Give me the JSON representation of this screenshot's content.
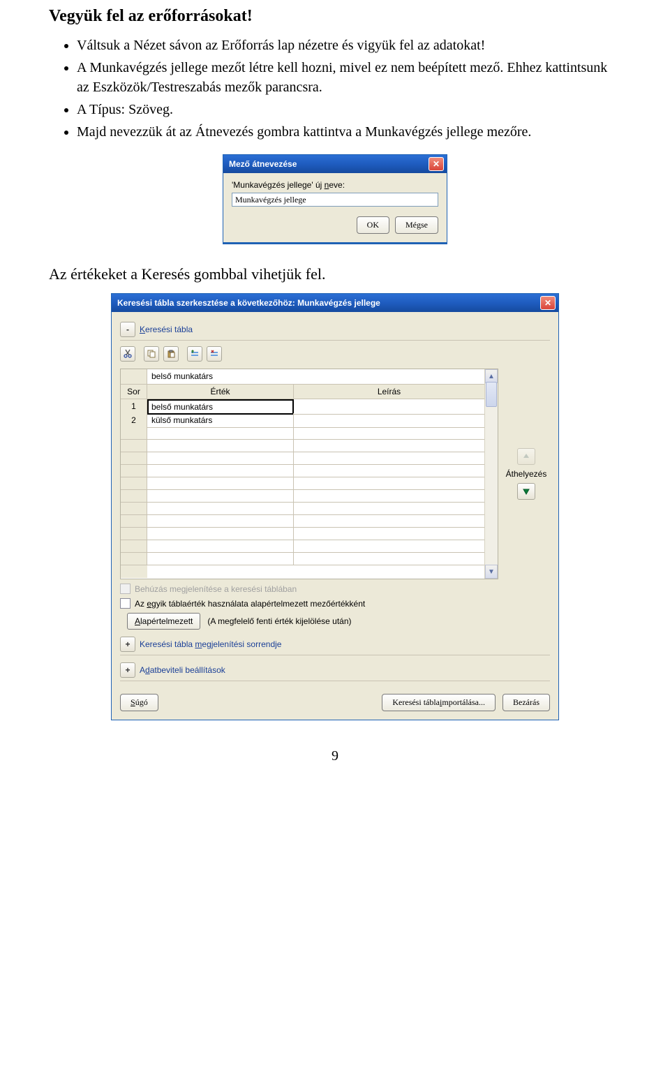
{
  "heading": "Vegyük fel az erőforrásokat!",
  "bullets": [
    "Váltsuk a Nézet sávon az Erőforrás lap nézetre és vigyük fel az adatokat!",
    "A Munkavégzés jellege mezőt létre kell hozni, mivel ez nem beépített mező. Ehhez kattintsunk az Eszközök/Testreszabás mezők parancsra.",
    "A Típus: Szöveg.",
    "Majd nevezzük át az Átnevezés gombra kattintva a Munkavégzés jellege mezőre."
  ],
  "dialog1": {
    "title": "Mező átnevezése",
    "label": "'Munkavégzés jellege' új neve:",
    "value": "Munkavégzés jellege",
    "ok": "OK",
    "cancel": "Mégse"
  },
  "para2": "Az értékeket a Keresés gombbal vihetjük fel.",
  "dialog2": {
    "title": "Keresési tábla szerkesztése a következőhöz: Munkavégzés jellege",
    "sectionLookup": "Keresési tábla",
    "topvalue": "belső munkatárs",
    "head": {
      "row": "Sor",
      "value": "Érték",
      "desc": "Leírás"
    },
    "rows": [
      {
        "n": "1",
        "v": "belső munkatárs",
        "d": ""
      },
      {
        "n": "2",
        "v": "külső munkatárs",
        "d": ""
      }
    ],
    "moveLabel": "Áthelyezés",
    "optIndent": "Behúzás megjelenítése a keresési táblában",
    "optDefault": "Az egyik táblaérték használata alapértelmezett mezőértékként",
    "defaultBtn": "Alapértelmezett",
    "defaultHint": "(A megfelelő fenti érték kijelölése után)",
    "sectionOrder": "Keresési tábla megjelenítési sorrendje",
    "sectionInput": "Adatbeviteli beállítások",
    "help": "Súgó",
    "import": "Keresési tábla importálása...",
    "close": "Bezárás"
  },
  "pageNumber": "9"
}
